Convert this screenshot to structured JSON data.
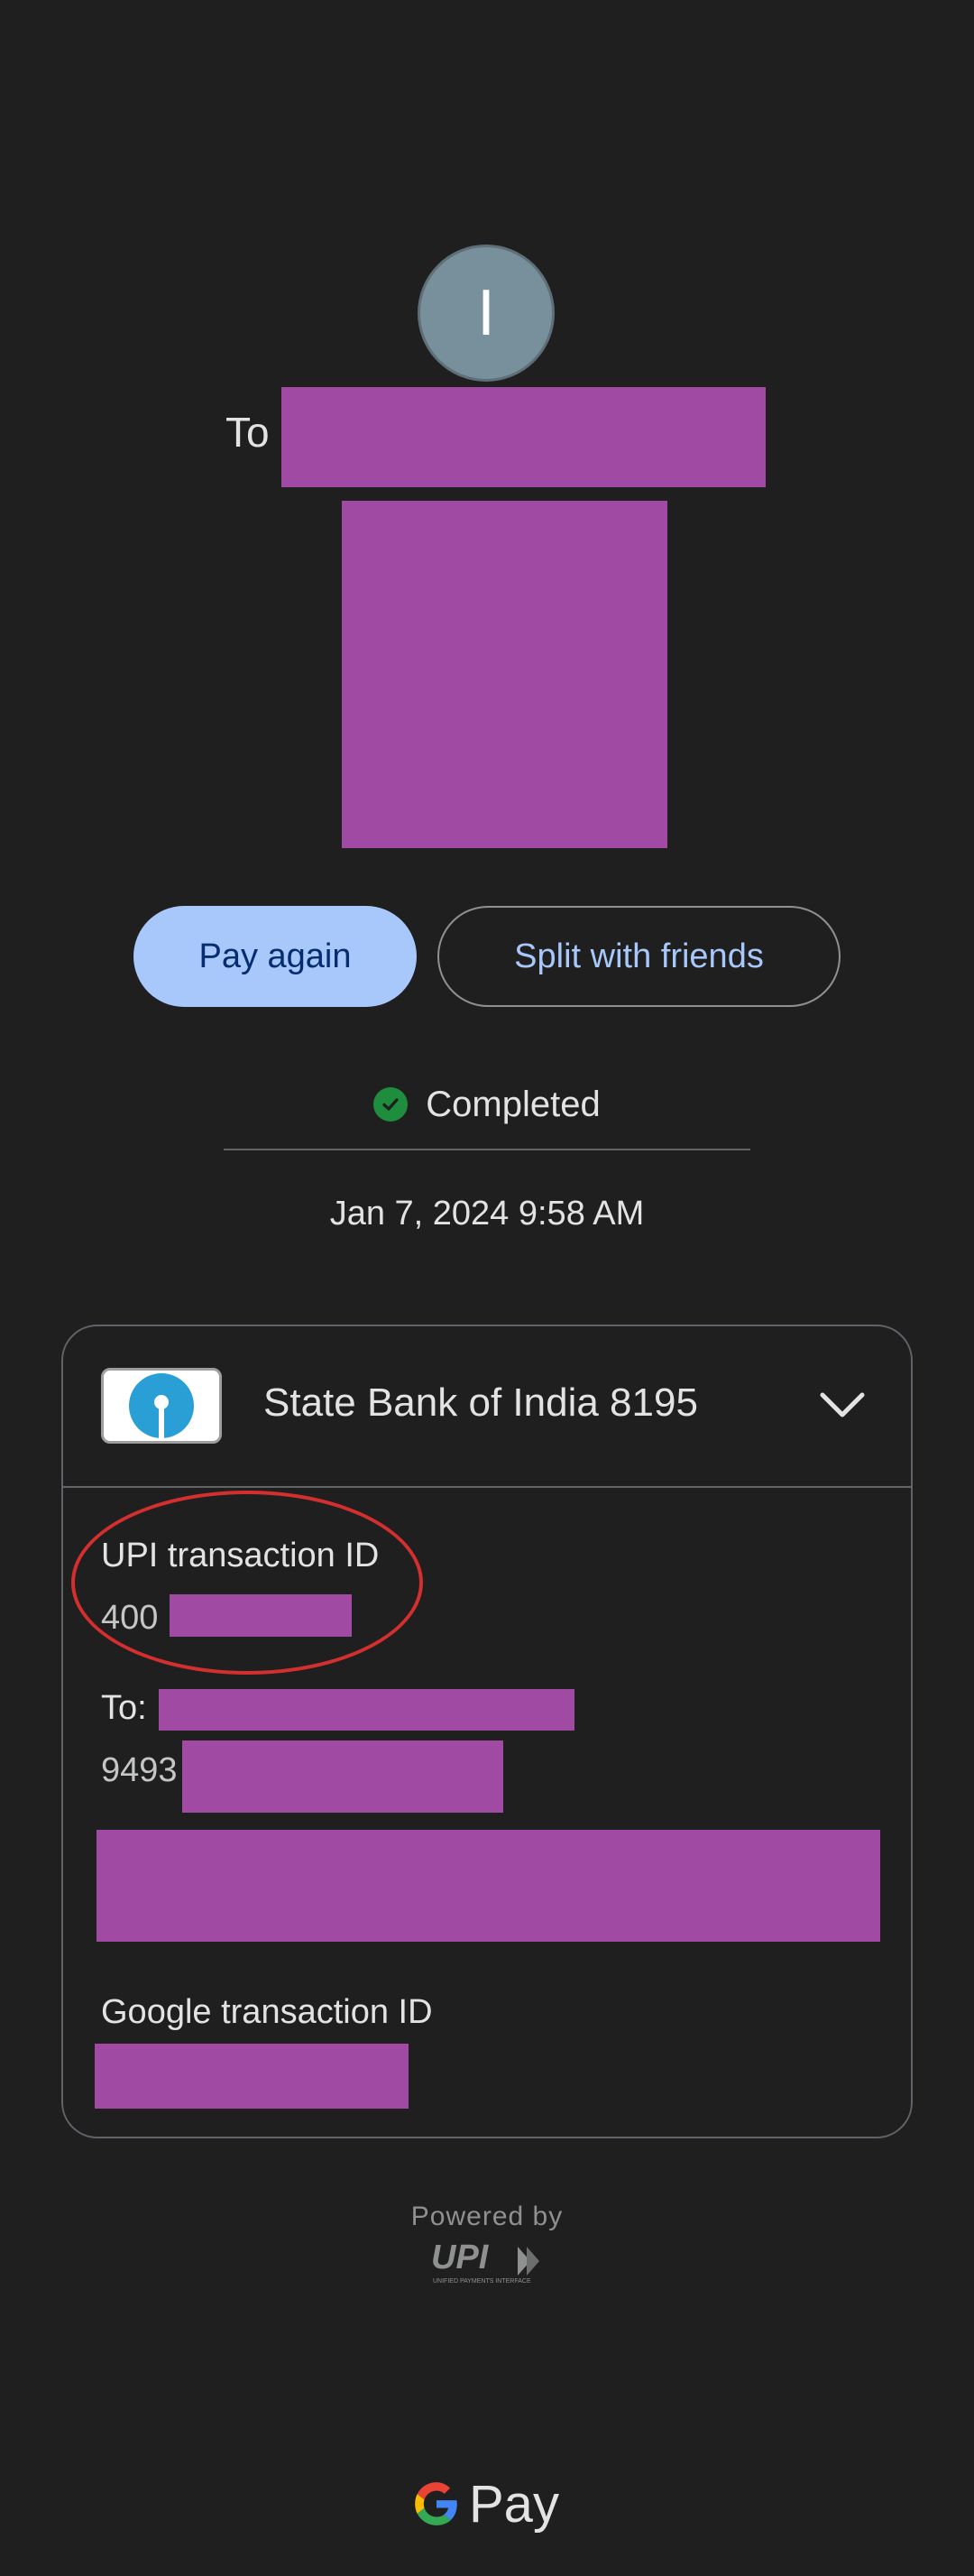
{
  "header": {
    "avatar_initial": "I",
    "to_prefix": "To"
  },
  "actions": {
    "pay_again": "Pay again",
    "split": "Split with friends"
  },
  "status": {
    "text": "Completed",
    "timestamp": "Jan 7, 2024 9:58 AM"
  },
  "details": {
    "bank_name": "State Bank of India 8195",
    "upi_txn_label": "UPI transaction ID",
    "upi_txn_prefix": "400",
    "to_label": "To:",
    "to_number_prefix": "9493",
    "google_txn_label": "Google transaction ID"
  },
  "footer": {
    "powered_by": "Powered by",
    "upi_logo_text": "UPI",
    "upi_logo_subtext": "UNIFIED PAYMENTS INTERFACE",
    "gpay_text": "Pay"
  },
  "colors": {
    "background": "#1f1f1f",
    "redaction": "#a04aa3",
    "primary_button": "#a8c7fa",
    "success": "#1e8e3e",
    "annotation_circle": "#d32f2f"
  },
  "icons": [
    "check-icon",
    "sbi-logo",
    "chevron-down-icon",
    "upi-logo",
    "google-g-logo"
  ]
}
